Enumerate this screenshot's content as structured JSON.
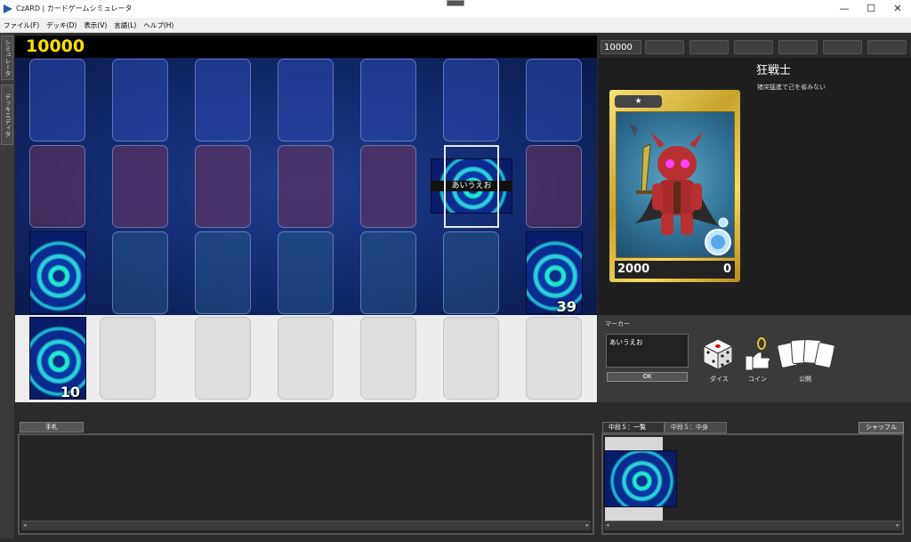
{
  "window": {
    "title": "CzARD | カードゲームシミュレータ",
    "minimize": "—",
    "maximize": "☐",
    "close": "✕"
  },
  "menu": [
    "ファイル(F)",
    "デッキ(D)",
    "表示(V)",
    "言語(L)",
    "ヘルプ(H)"
  ],
  "side_tabs": [
    "シミュレータ",
    "デッキエディタ"
  ],
  "player": {
    "life_points": "10000",
    "lp_box": "10000"
  },
  "field": {
    "selected_card_label": "あいうえお",
    "deck_count": "39",
    "hand_zone_count": "10"
  },
  "card_detail": {
    "name": "狂戦士",
    "text": "猪突猛進で己を省みない",
    "level": "★",
    "attack": "2000",
    "defense": "0"
  },
  "marker": {
    "label": "マーカー",
    "value": "あいうえお",
    "ok": "OK"
  },
  "tools": {
    "dice": "ダイス",
    "coin": "コイン",
    "reveal": "公開"
  },
  "hand": {
    "tab": "手札"
  },
  "deck_view": {
    "tab_list": "中段５：一覧",
    "tab_contents": "中段５：中身",
    "shuffle": "シャッフル"
  },
  "colors": {
    "life_text": "#ffe000",
    "field_blue": "#1e3d8c",
    "gold_frame": "#c9a22b"
  }
}
